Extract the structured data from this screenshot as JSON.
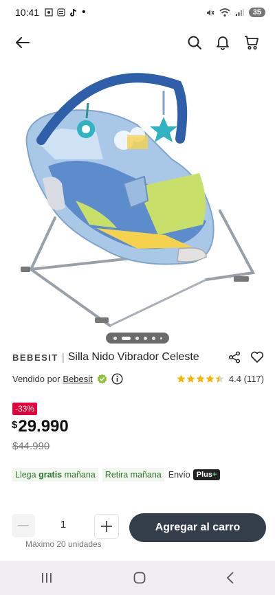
{
  "status": {
    "time": "10:41",
    "battery": "35"
  },
  "product": {
    "brand": "BEBESIT",
    "separator": "|",
    "name": "Silla Nido Vibrador Celeste",
    "seller_prefix": "Vendido por",
    "seller": "Bebesit",
    "rating_text": "4.4 (117)",
    "rating_value": 4.4,
    "discount": "-33%",
    "currency": "$",
    "price": "29.990",
    "old_price": "$44.990"
  },
  "delivery": {
    "arrives_prefix": "Llega",
    "arrives_bold": "gratis",
    "arrives_suffix": "mañana",
    "pickup": "Retira mañana",
    "envio": "Envío",
    "plus": "Plus",
    "plus_sign": "+"
  },
  "cart": {
    "quantity": "1",
    "max_note": "Máximo 20 unidades",
    "add_label": "Agregar al carro"
  },
  "carousel": {
    "slide_count": 6,
    "active_index": 1
  },
  "colors": {
    "discount": "#e4003a",
    "button": "#343e4a",
    "green": "#2d7a2d"
  }
}
